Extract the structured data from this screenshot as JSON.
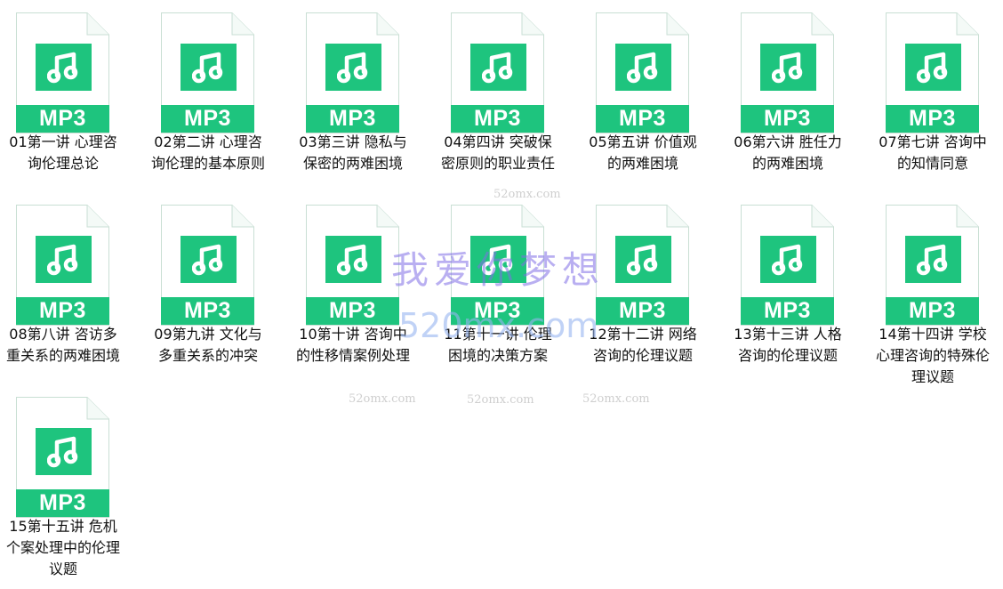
{
  "accent_color": "#1ec47e",
  "file_icon": "mp3-music-file-icon",
  "badge_text": "MP3",
  "files": [
    {
      "name": "01第一讲 心理咨询伦理总论"
    },
    {
      "name": "02第二讲 心理咨询伦理的基本原则"
    },
    {
      "name": "03第三讲 隐私与保密的两难困境"
    },
    {
      "name": "04第四讲 突破保密原则的职业责任"
    },
    {
      "name": "05第五讲  价值观的两难困境"
    },
    {
      "name": "06第六讲 胜任力的两难困境"
    },
    {
      "name": "07第七讲 咨询中的知情同意"
    },
    {
      "name": "08第八讲 咨访多重关系的两难困境"
    },
    {
      "name": "09第九讲 文化与多重关系的冲突"
    },
    {
      "name": "10第十讲 咨询中的性移情案例处理"
    },
    {
      "name": "11第十一讲 伦理困境的决策方案"
    },
    {
      "name": "12第十二讲 网络咨询的伦理议题"
    },
    {
      "name": "13第十三讲 人格咨询的伦理议题"
    },
    {
      "name": "14第十四讲 学校心理咨询的特殊伦理议题"
    },
    {
      "name": "15第十五讲 危机个案处理中的伦理议题"
    }
  ],
  "watermarks": {
    "main": "我爱你梦想",
    "site": "520mx.com",
    "small": "52omx.com"
  }
}
